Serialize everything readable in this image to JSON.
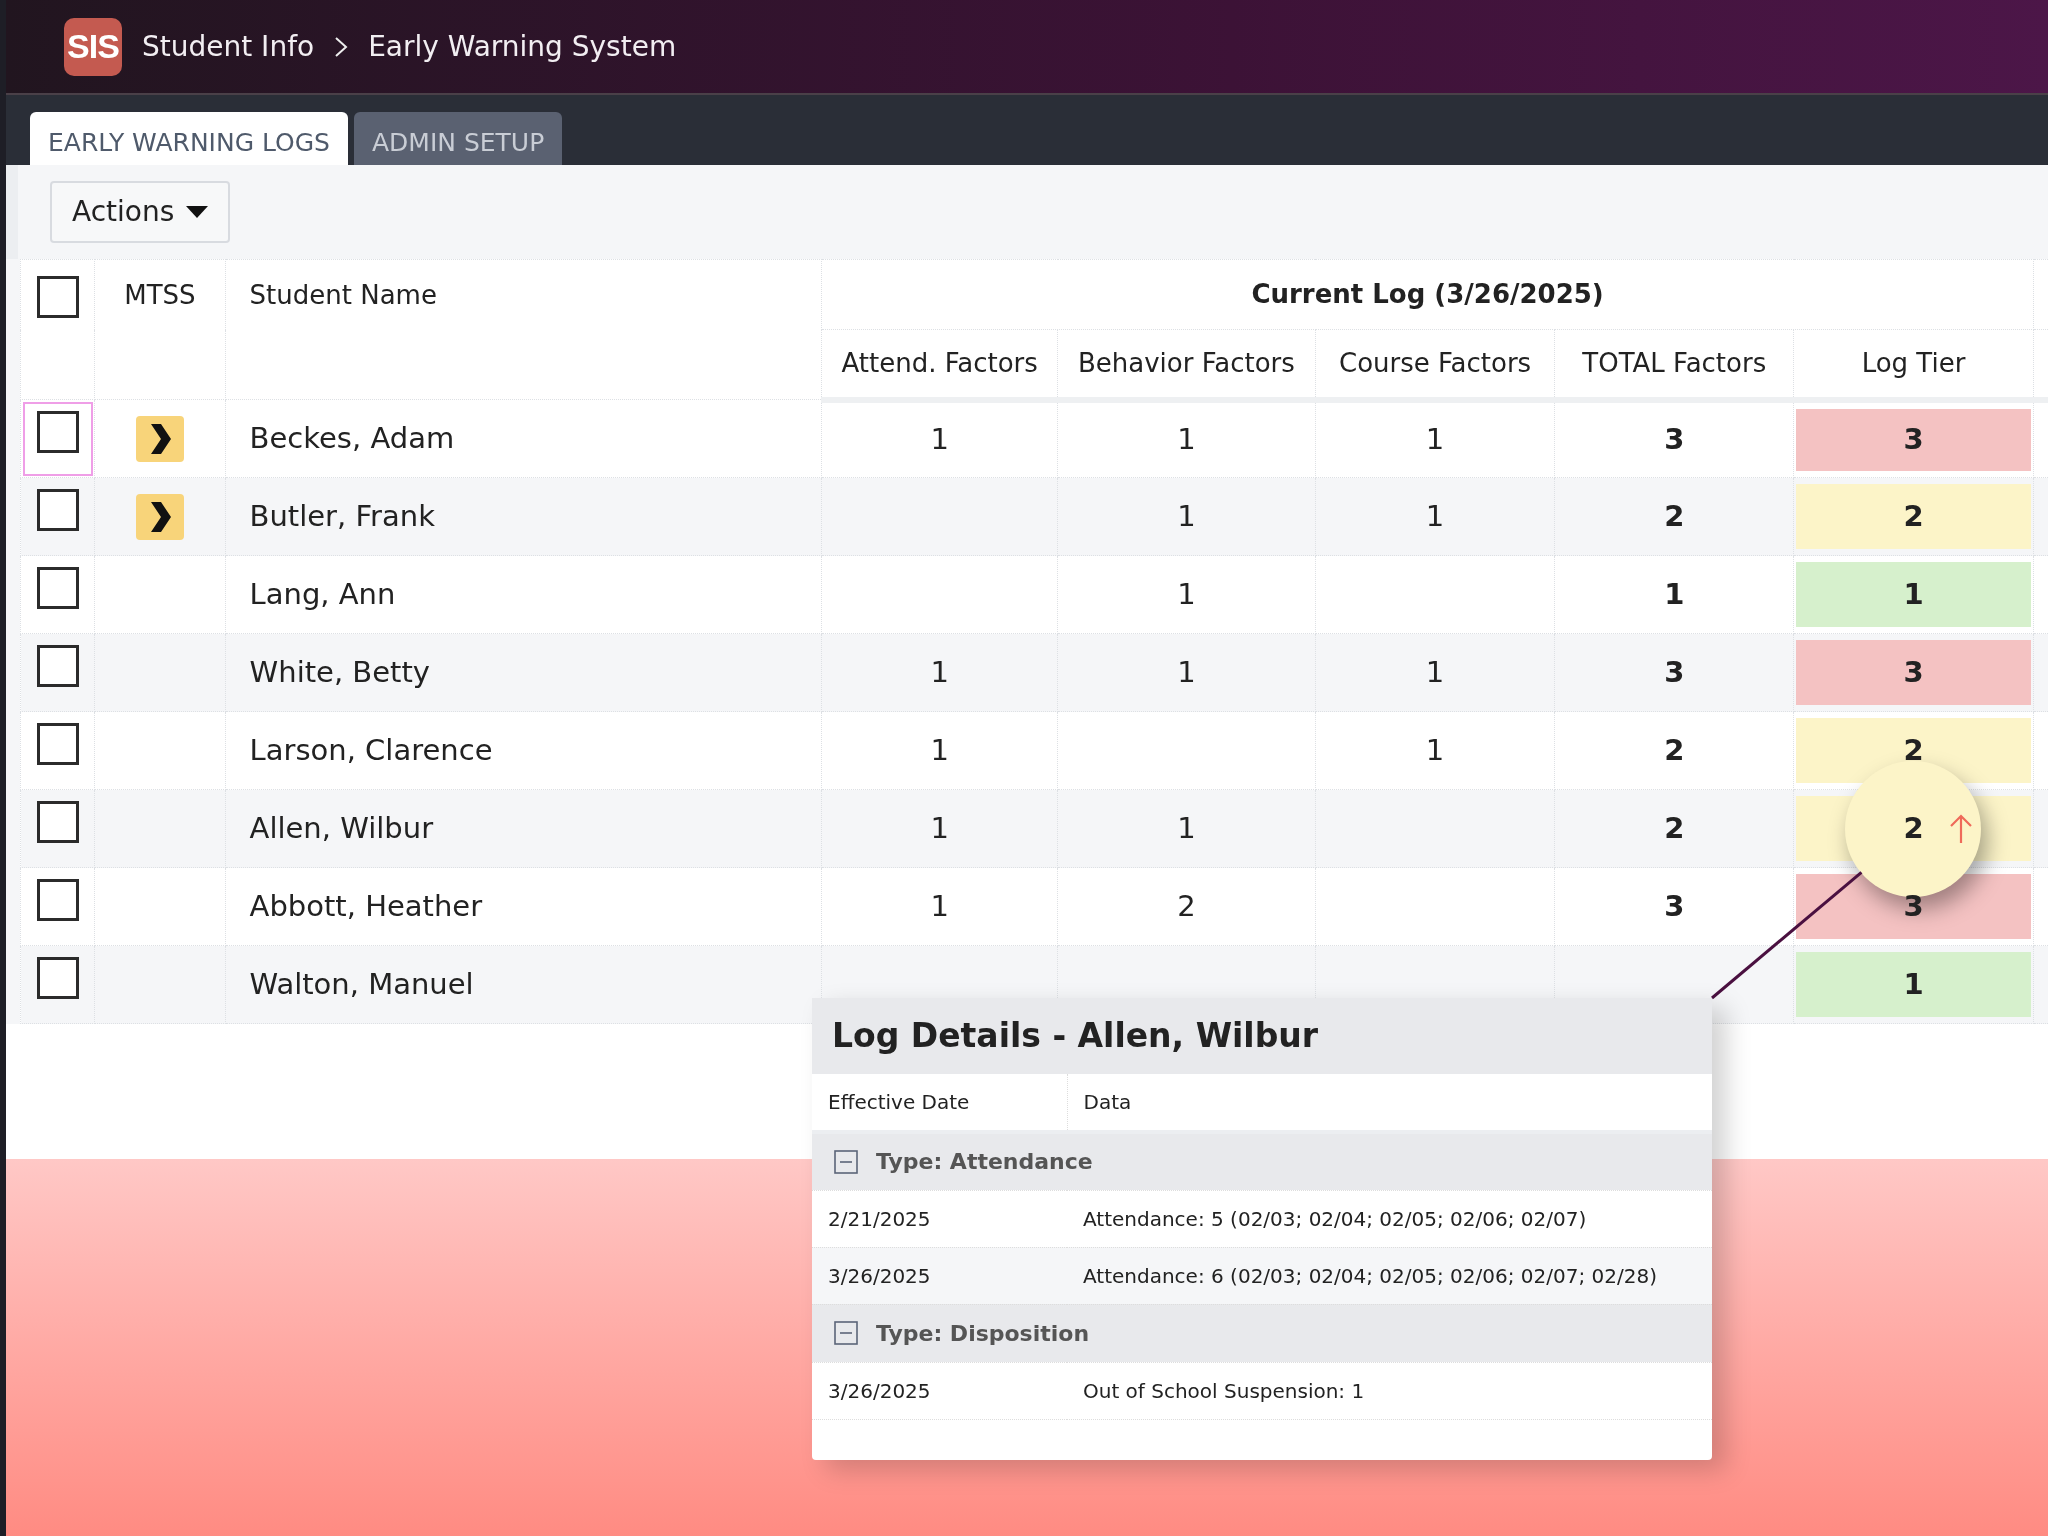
{
  "header": {
    "logo": "SIS",
    "breadcrumb": [
      "Student Info",
      "Early Warning System"
    ]
  },
  "tabs": [
    {
      "label": "EARLY WARNING LOGS",
      "selected": true
    },
    {
      "label": "ADMIN SETUP",
      "selected": false
    }
  ],
  "actions_button": "Actions",
  "table": {
    "group_heading": "Current Log (3/26/2025)",
    "columns": [
      "MTSS",
      "Student Name",
      "Attend. Factors",
      "Behavior Factors",
      "Course Factors",
      "TOTAL Factors",
      "Log Tier"
    ],
    "select_all_checked": false,
    "rows": [
      {
        "checked": false,
        "focused": true,
        "mtss": true,
        "name": "Beckes, Adam",
        "attend": "1",
        "behavior": "1",
        "course": "1",
        "total": "3",
        "tier": "3",
        "color": "#f4c2c2",
        "rising": false,
        "magnified": false
      },
      {
        "checked": false,
        "focused": false,
        "mtss": true,
        "name": "Butler, Frank",
        "behavior": "1",
        "course": "1",
        "total": "2",
        "tier": "2",
        "color": "#fcf4c8",
        "rising": false,
        "magnified": false
      },
      {
        "checked": false,
        "focused": false,
        "mtss": false,
        "name": "Lang, Ann",
        "behavior": "1",
        "total": "1",
        "tier": "1",
        "color": "#d6f0cc",
        "rising": false,
        "magnified": false
      },
      {
        "checked": false,
        "focused": false,
        "mtss": false,
        "name": "White, Betty",
        "attend": "1",
        "behavior": "1",
        "course": "1",
        "total": "3",
        "tier": "3",
        "color": "#f4c2c2",
        "rising": false,
        "magnified": false
      },
      {
        "checked": false,
        "focused": false,
        "mtss": false,
        "name": "Larson, Clarence",
        "attend": "1",
        "course": "1",
        "total": "2",
        "tier": "2",
        "color": "#fcf4c8",
        "rising": false,
        "magnified": false
      },
      {
        "checked": false,
        "focused": false,
        "mtss": false,
        "name": "Allen, Wilbur",
        "attend": "1",
        "behavior": "1",
        "total": "2",
        "tier": "2",
        "color": "#fcf4c8",
        "rising": true,
        "magnified": true
      },
      {
        "checked": false,
        "focused": false,
        "mtss": false,
        "name": "Abbott, Heather",
        "attend": "1",
        "behavior": "2",
        "total": "3",
        "tier": "3",
        "color": "#f4c2c2",
        "rising": false,
        "magnified": false
      },
      {
        "checked": false,
        "focused": false,
        "mtss": false,
        "name": "Walton, Manuel",
        "tier": "1",
        "color": "#d6f0cc",
        "rising": false,
        "magnified": false
      }
    ]
  },
  "log_details": {
    "title": "Log Details - Allen, Wilbur",
    "columns": [
      "Effective Date",
      "Data"
    ],
    "groups": [
      {
        "label": "Type: Attendance",
        "expanded": true,
        "rows": [
          {
            "date": "2/21/2025",
            "data": "Attendance: 5 (02/03; 02/04; 02/05; 02/06; 02/07)"
          },
          {
            "date": "3/26/2025",
            "data": "Attendance: 6 (02/03; 02/04; 02/05; 02/06; 02/07; 02/28)"
          }
        ]
      },
      {
        "label": "Type: Disposition",
        "expanded": true,
        "rows": [
          {
            "date": "3/26/2025",
            "data": "Out of School Suspension: 1"
          }
        ]
      }
    ]
  }
}
